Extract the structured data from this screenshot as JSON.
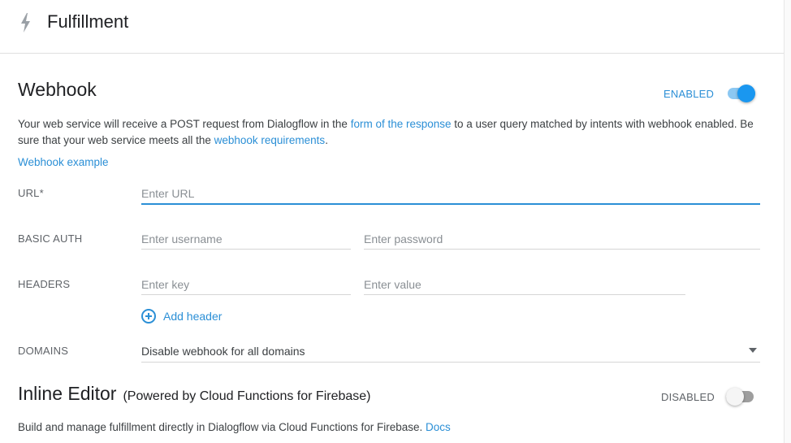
{
  "header": {
    "title": "Fulfillment",
    "icon": "bolt-icon"
  },
  "webhook": {
    "title": "Webhook",
    "status_label": "ENABLED",
    "enabled": true,
    "desc_part1": "Your web service will receive a POST request from Dialogflow in the ",
    "desc_link1": "form of the response",
    "desc_part2": " to a user query matched by intents with webhook enabled. Be sure that your web service meets all the ",
    "desc_link2": "webhook requirements",
    "desc_part3": ".",
    "example_link": "Webhook example",
    "url_label": "URL*",
    "url_placeholder": "Enter URL",
    "basic_auth_label": "BASIC AUTH",
    "username_placeholder": "Enter username",
    "password_placeholder": "Enter password",
    "headers_label": "HEADERS",
    "key_placeholder": "Enter key",
    "value_placeholder": "Enter value",
    "add_header": "Add header",
    "domains_label": "DOMAINS",
    "domains_value": "Disable webhook for all domains"
  },
  "inline_editor": {
    "title": "Inline Editor",
    "subtitle": "(Powered by Cloud Functions for Firebase)",
    "status_label": "DISABLED",
    "enabled": false,
    "desc": "Build and manage fulfillment directly in Dialogflow via Cloud Functions for Firebase. ",
    "docs_link": "Docs"
  },
  "colors": {
    "accent": "#2b8fd6",
    "toggle_on": "#1a97f0",
    "toggle_off": "#9e9e9e"
  }
}
